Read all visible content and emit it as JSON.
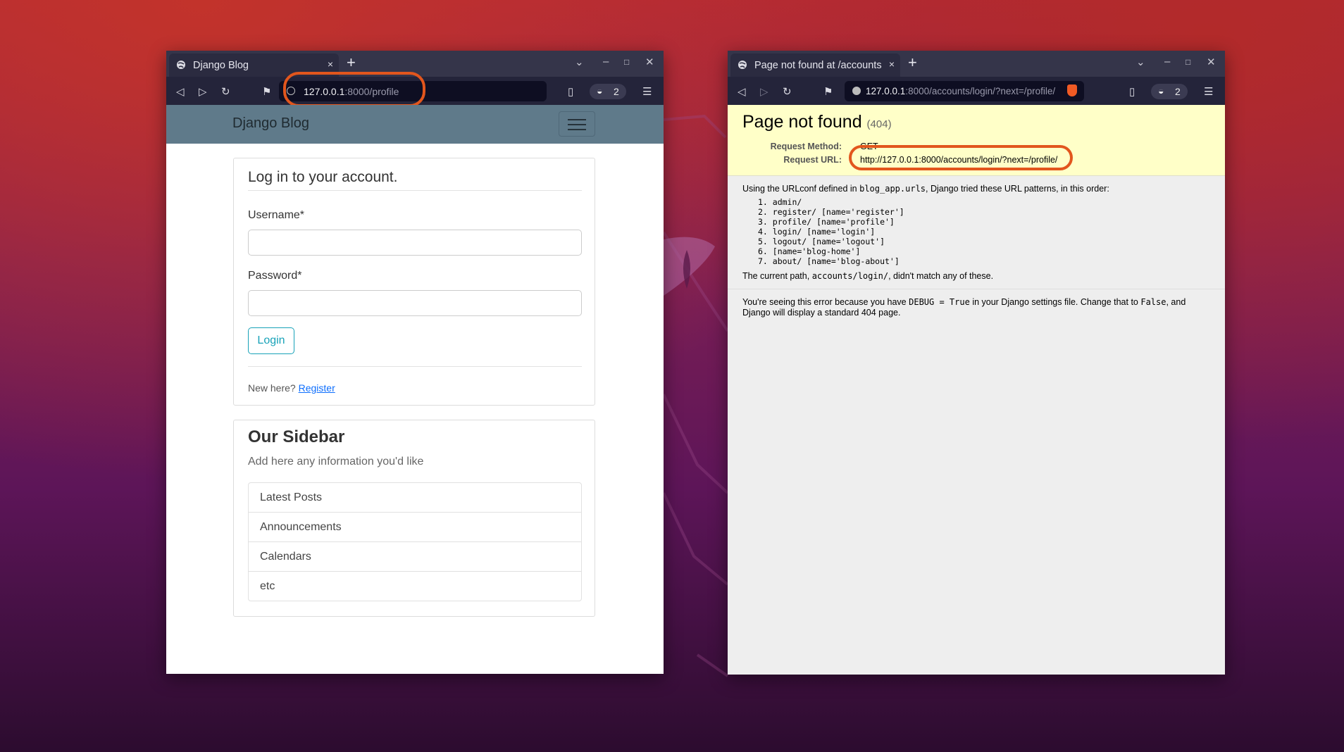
{
  "window1": {
    "tab_title": "Django Blog",
    "tab_close": "×",
    "new_tab": "+",
    "url_host": "127.0.0.1",
    "url_rest": ":8000/profile",
    "shields_count": "2",
    "page": {
      "brand": "Django Blog",
      "login_title": "Log in to your account.",
      "username_label": "Username*",
      "password_label": "Password*",
      "login_button": "Login",
      "new_here": "New here?",
      "register_link": "Register",
      "sidebar_title": "Our Sidebar",
      "sidebar_subtitle": "Add here any information you'd like",
      "sidebar_items": [
        "Latest Posts",
        "Announcements",
        "Calendars",
        "etc"
      ]
    }
  },
  "window2": {
    "tab_title": "Page not found at /accounts",
    "tab_close": "×",
    "new_tab": "+",
    "url_host": "127.0.0.1",
    "url_rest": ":8000/accounts/login/?next=/profile/",
    "shields_count": "2",
    "page": {
      "title": "Page not found",
      "status": "(404)",
      "request_method_label": "Request Method:",
      "request_method": "GET",
      "request_url_label": "Request URL:",
      "request_url": "http://127.0.0.1:8000/accounts/login/?next=/profile/",
      "urlconf_pre": "Using the URLconf defined in",
      "urlconf_module": "blog_app.urls",
      "urlconf_post": ", Django tried these URL patterns, in this order:",
      "patterns": [
        "1. admin/",
        "2. register/ [name='register']",
        "3. profile/ [name='profile']",
        "4. login/ [name='login']",
        "5. logout/ [name='logout']",
        "6. [name='blog-home']",
        "7. about/ [name='blog-about']"
      ],
      "current_pre": "The current path,",
      "current_path": "accounts/login/",
      "current_post": ", didn't match any of these.",
      "debug_1": "You're seeing this error because you have",
      "debug_code": "DEBUG = True",
      "debug_2": "in your Django settings file. Change that to",
      "debug_false": "False",
      "debug_3": ", and Django will display a standard 404 page."
    }
  },
  "colors": {
    "highlight": "#e2561d",
    "link": "#0d6efd",
    "button": "#17a2b8",
    "navbar": "#5f7a8a",
    "error_header": "#ffffc8"
  }
}
